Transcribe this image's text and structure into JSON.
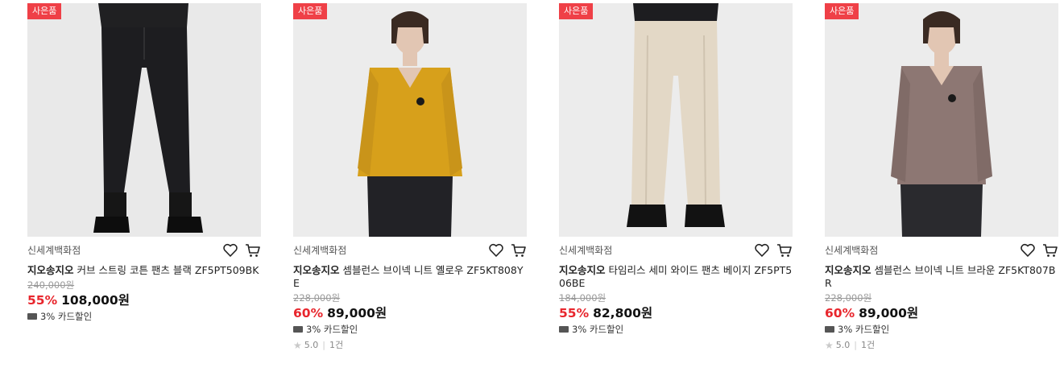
{
  "products": [
    {
      "badge": "사은품",
      "seller": "신세계백화점",
      "brand": "지오송지오",
      "name": "커브 스트링 코튼 팬츠 블랙 ZF5PT509BK",
      "original_price": "240,000원",
      "discount": "55%",
      "price": "108,000원",
      "coupon": "3% 카드할인",
      "has_review": false,
      "image_color": "#1d1d20"
    },
    {
      "badge": "사은품",
      "seller": "신세계백화점",
      "brand": "지오송지오",
      "name": "셈블런스 브이넥 니트 옐로우 ZF5KT808YE",
      "original_price": "228,000원",
      "discount": "60%",
      "price": "89,000원",
      "coupon": "3% 카드할인",
      "has_review": true,
      "rating": "5.0",
      "review_count": "1건",
      "image_color": "#d7a01b"
    },
    {
      "badge": "사은품",
      "seller": "신세계백화점",
      "brand": "지오송지오",
      "name": "타임리스 세미 와이드 팬츠 베이지 ZF5PT506BE",
      "original_price": "184,000원",
      "discount": "55%",
      "price": "82,800원",
      "coupon": "3% 카드할인",
      "has_review": false,
      "image_color": "#e3d8c6"
    },
    {
      "badge": "사은품",
      "seller": "신세계백화점",
      "brand": "지오송지오",
      "name": "셈블런스 브이넥 니트 브라운 ZF5KT807BR",
      "original_price": "228,000원",
      "discount": "60%",
      "price": "89,000원",
      "coupon": "3% 카드할인",
      "has_review": true,
      "rating": "5.0",
      "review_count": "1건",
      "image_color": "#8d7773"
    }
  ]
}
